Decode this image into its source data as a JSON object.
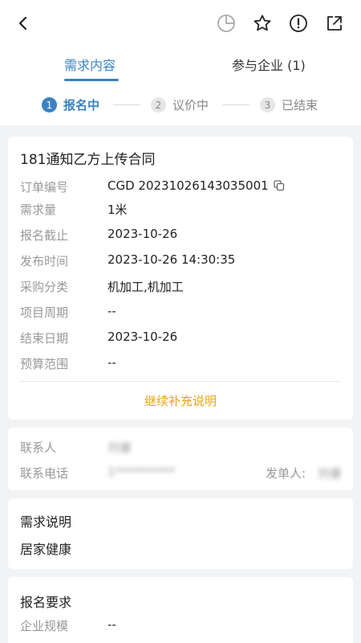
{
  "header": {
    "back_icon": "chevron-left-icon",
    "actions": [
      "pie-chart-icon",
      "star-icon",
      "alert-icon",
      "share-icon"
    ]
  },
  "tabs": [
    {
      "label": "需求内容",
      "active": true
    },
    {
      "label": "参与企业 (1)",
      "active": false
    }
  ],
  "steps": [
    {
      "num": "1",
      "label": "报名中",
      "active": true
    },
    {
      "num": "2",
      "label": "议价中",
      "active": false
    },
    {
      "num": "3",
      "label": "已结束",
      "active": false
    }
  ],
  "order": {
    "title": "181通知乙方上传合同",
    "fields": [
      {
        "label": "订单编号",
        "value": "CGD 20231026143035001"
      },
      {
        "label": "需求量",
        "value": "1米"
      },
      {
        "label": "报名截止",
        "value": "2023-10-26"
      },
      {
        "label": "发布时间",
        "value": "2023-10-26 14:30:35"
      },
      {
        "label": "采购分类",
        "value": "机加工,机加工"
      },
      {
        "label": "项目周期",
        "value": "--"
      },
      {
        "label": "结束日期",
        "value": "2023-10-26"
      },
      {
        "label": "预算范围",
        "value": "--"
      }
    ],
    "supplement_label": "继续补充说明"
  },
  "contact": {
    "person_label": "联系人",
    "person_value": "刘睿",
    "phone_label": "联系电话",
    "phone_value": "1**********",
    "issuer_label": "发单人:",
    "issuer_value": "刘睿"
  },
  "description": {
    "title": "需求说明",
    "content": "居家健康"
  },
  "requirements": {
    "title": "报名要求",
    "fields": [
      {
        "label": "企业规模",
        "value": "--"
      }
    ]
  },
  "colors": {
    "accent": "#3b82c4",
    "supplement": "#e9a317",
    "label": "#999999"
  }
}
